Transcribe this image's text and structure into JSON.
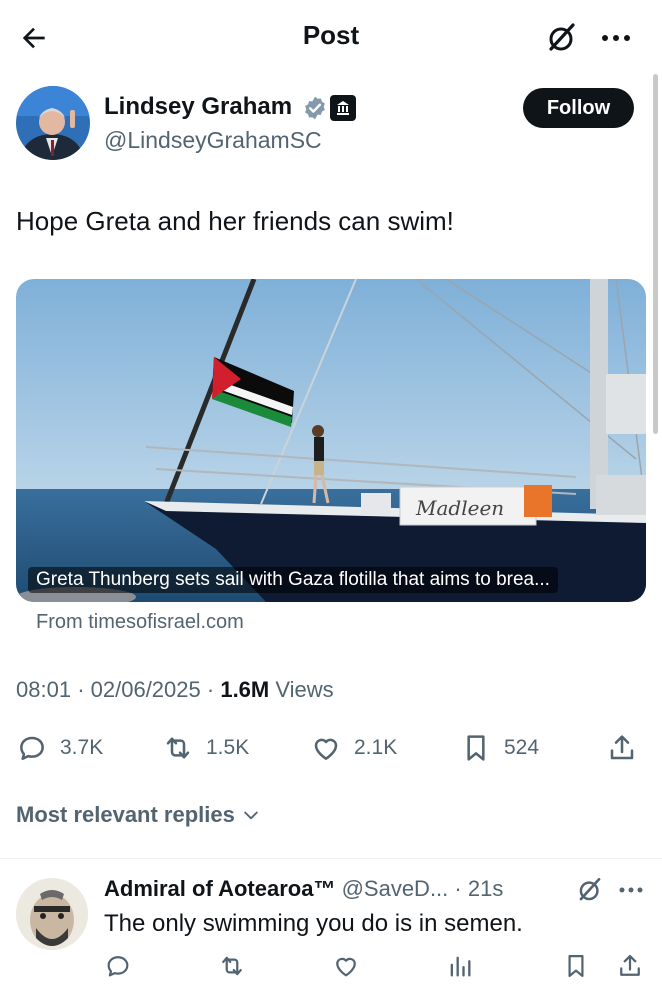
{
  "topbar": {
    "title": "Post",
    "back_icon": "arrow-left-icon",
    "grok_icon": "grok-icon",
    "more_icon": "more-horizontal-icon"
  },
  "author": {
    "name": "Lindsey Graham",
    "handle": "@LindseyGrahamSC",
    "follow_label": "Follow",
    "verified_icon": "verified-badge-icon",
    "affiliation_icon": "government-building-icon",
    "verified_color": "#829aab"
  },
  "post": {
    "text": "Hope Greta and her friends can swim!",
    "card": {
      "caption": "Greta Thunberg sets sail with Gaza flotilla that aims to brea...",
      "source": "From timesofisrael.com",
      "boat_name": "Madleen"
    },
    "time": "08:01",
    "date": "02/06/2025",
    "views_count": "1.6M",
    "views_label": "Views"
  },
  "actions": {
    "replies": "3.7K",
    "reposts": "1.5K",
    "likes": "2.1K",
    "bookmarks": "524"
  },
  "replies_header": {
    "label": "Most relevant replies"
  },
  "reply": {
    "name": "Admiral of Aotearoa™",
    "handle": "@SaveD...",
    "separator": "·",
    "time": "21s",
    "text": "The only swimming you do is in semen."
  },
  "colors": {
    "text": "#0f1419",
    "secondary": "#536471",
    "follow_bg": "#0f1419"
  }
}
